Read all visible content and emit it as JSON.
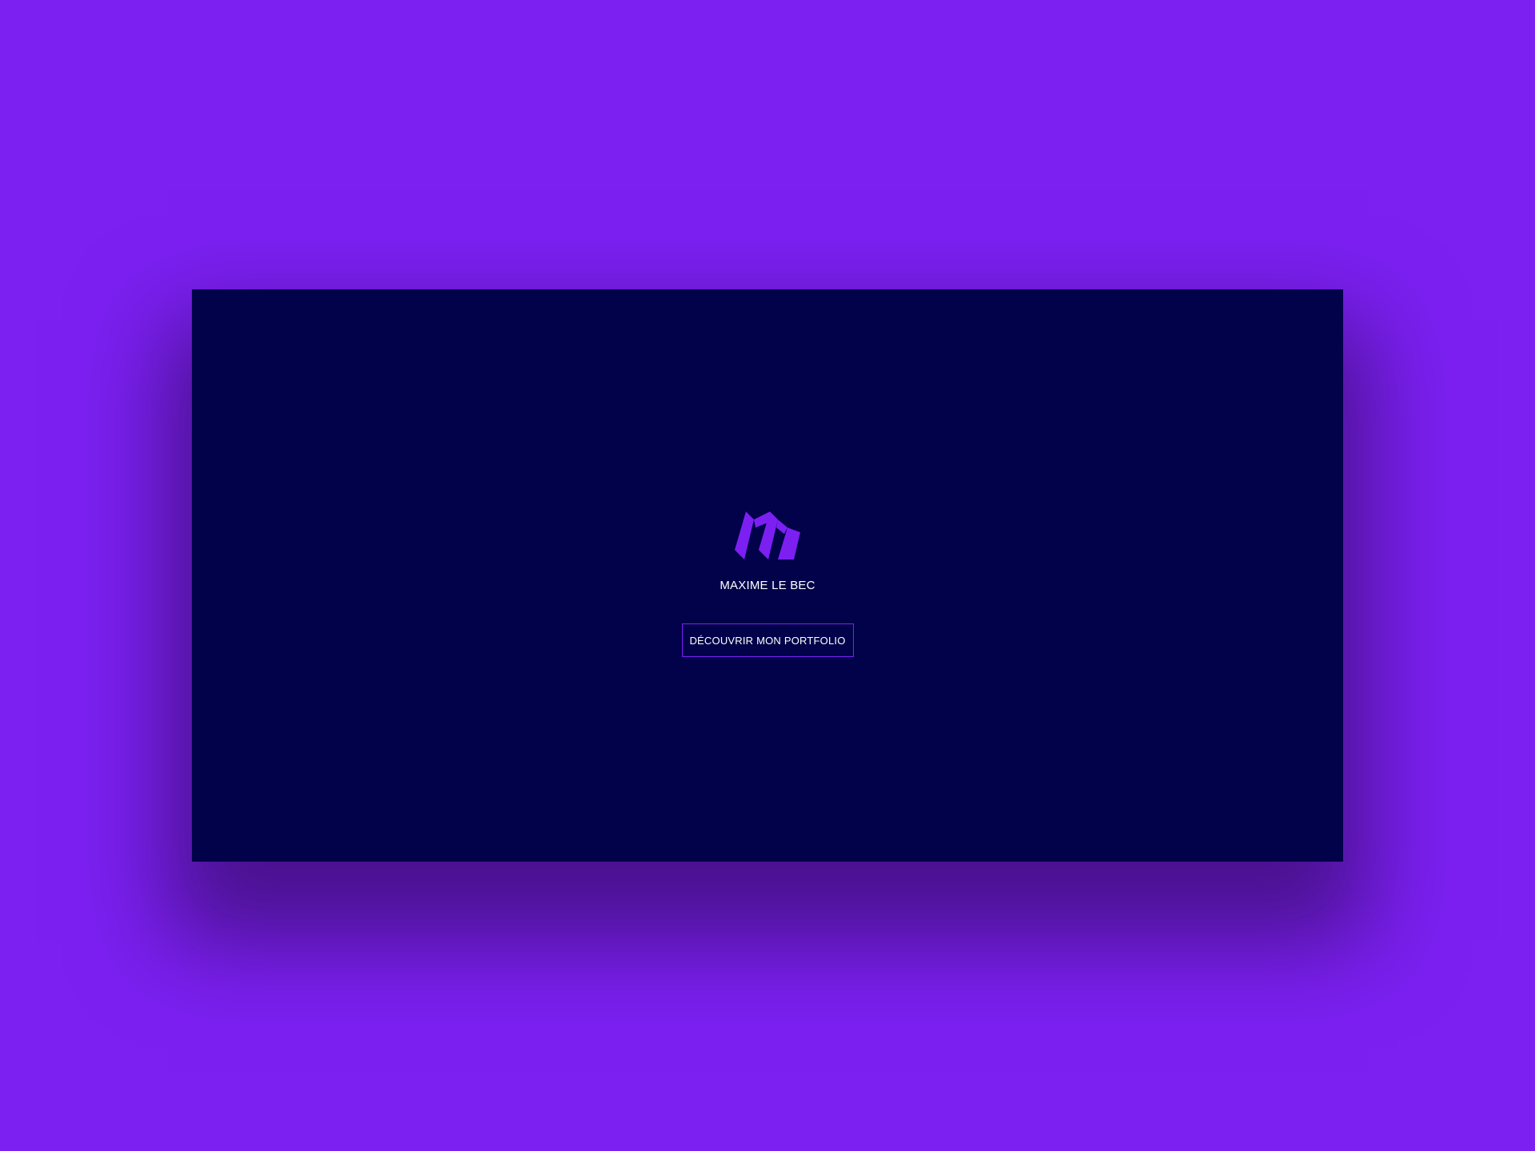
{
  "colors": {
    "background": "#7c20f2",
    "panel": "#02024a",
    "accent": "#7c20f2",
    "text": "#ffffff"
  },
  "brand": {
    "logo_icon": "monogram-m-icon",
    "name": "MAXIME LE BEC"
  },
  "cta": {
    "label": "DÉCOUVRIR MON PORTFOLIO"
  }
}
